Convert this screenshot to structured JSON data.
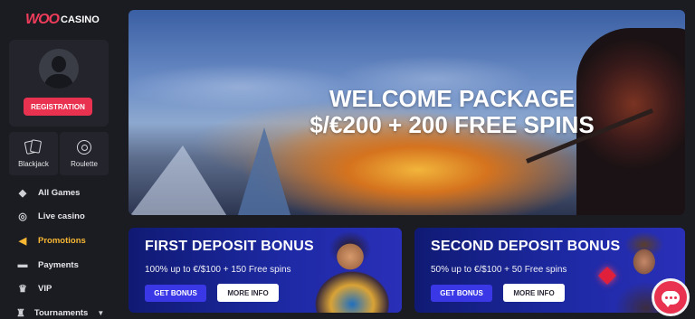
{
  "brand": {
    "logo_primary": "WOO",
    "logo_secondary": "CASINO",
    "accent": "#e8324f"
  },
  "sidebar": {
    "registration_label": "REGISTRATION",
    "games": [
      {
        "label": "Blackjack",
        "icon": "cards-icon"
      },
      {
        "label": "Roulette",
        "icon": "roulette-icon"
      }
    ],
    "menu": [
      {
        "label": "All Games",
        "icon": "dice-icon"
      },
      {
        "label": "Live casino",
        "icon": "chip-icon"
      },
      {
        "label": "Promotions",
        "icon": "megaphone-icon",
        "active": true
      },
      {
        "label": "Payments",
        "icon": "wallet-icon"
      },
      {
        "label": "VIP",
        "icon": "crown-icon"
      },
      {
        "label": "Tournaments",
        "icon": "trophy-icon"
      }
    ],
    "active_color": "#f7b733"
  },
  "hero": {
    "line1": "WELCOME PACKAGE",
    "line2": "$/€200 + 200 FREE SPINS"
  },
  "bonuses": [
    {
      "title": "FIRST DEPOSIT BONUS",
      "description": "100% up to €/$100 + 150 Free spins",
      "get_label": "GET BONUS",
      "more_label": "MORE INFO"
    },
    {
      "title": "SECOND DEPOSIT BONUS",
      "description": "50% up to €/$100 + 50 Free spins",
      "get_label": "GET BONUS",
      "more_label": "MORE INFO"
    }
  ],
  "chat": {
    "icon": "chat-icon"
  }
}
